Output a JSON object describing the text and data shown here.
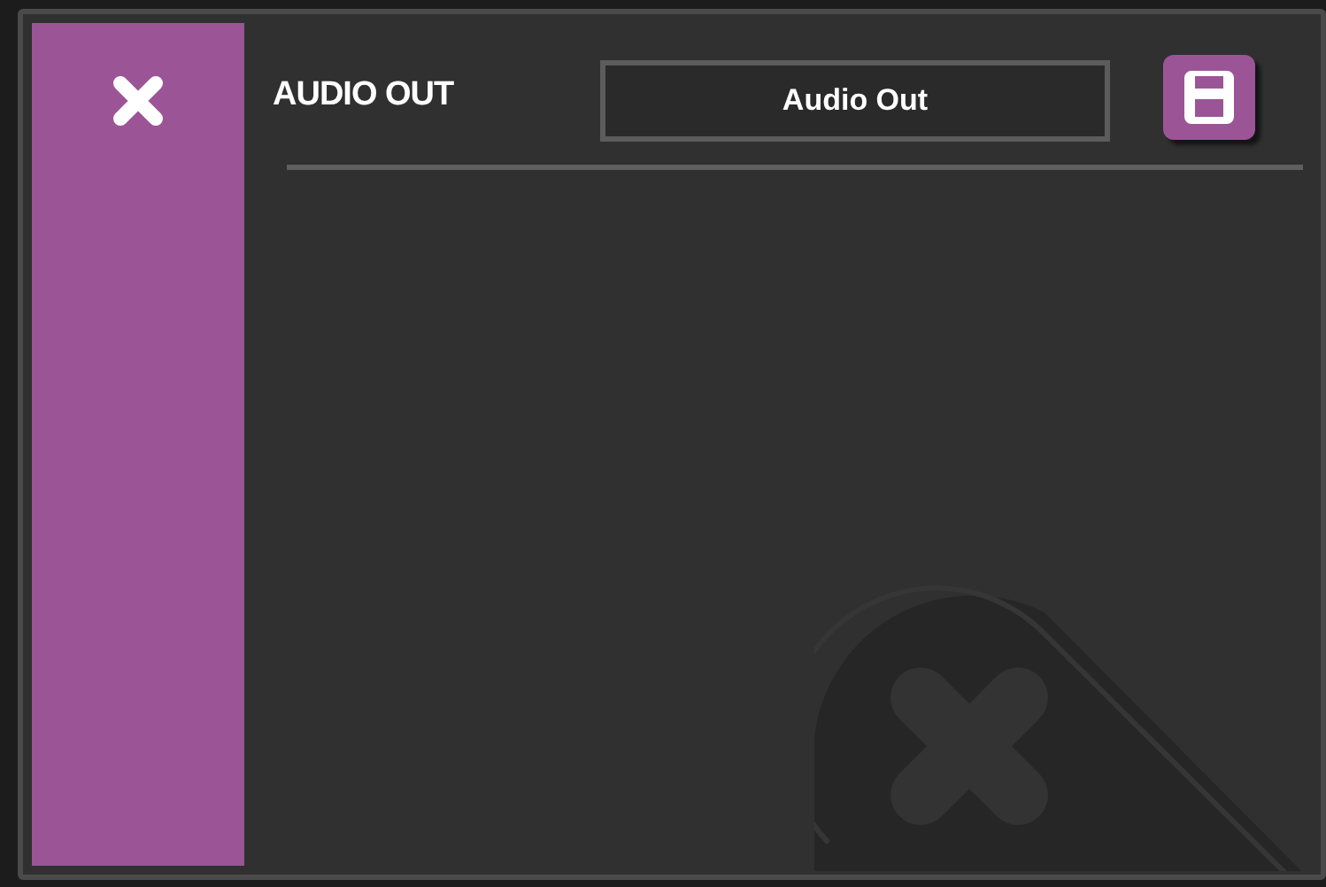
{
  "panel": {
    "title": "AUDIO OUT",
    "name_field": {
      "value": "Audio Out"
    }
  }
}
